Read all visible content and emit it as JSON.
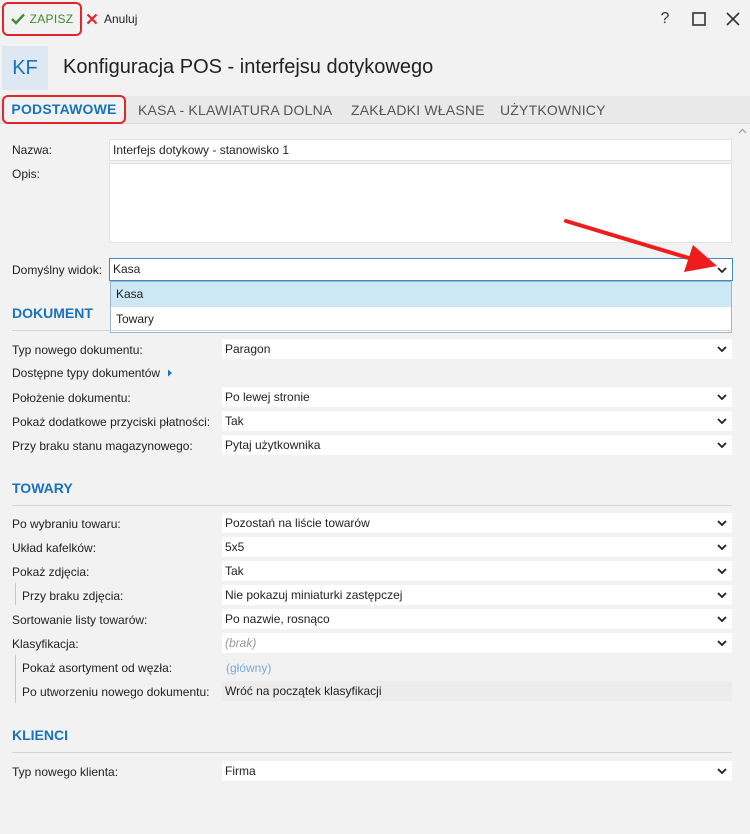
{
  "toolbar": {
    "save_label": "ZAPISZ",
    "cancel_label": "Anuluj",
    "help_glyph": "?",
    "maximize_glyph": "☐",
    "close_glyph": "✕"
  },
  "header": {
    "badge": "KF",
    "title": "Konfiguracja POS - interfejsu dotykowego"
  },
  "tabs": [
    {
      "label": "PODSTAWOWE",
      "active": true
    },
    {
      "label": "KASA - KLAWIATURA DOLNA",
      "active": false
    },
    {
      "label": "ZAKŁADKI WŁASNE",
      "active": false
    },
    {
      "label": "UŻYTKOWNICY",
      "active": false
    }
  ],
  "form": {
    "name_label": "Nazwa:",
    "name_value": "Interfejs dotykowy - stanowisko 1",
    "desc_label": "Opis:",
    "desc_value": "",
    "default_view_label": "Domyślny widok:",
    "default_view_value": "Kasa",
    "default_view_options": [
      "Kasa",
      "Towary"
    ]
  },
  "dokument": {
    "section_title": "DOKUMENT",
    "doc_type_label": "Typ nowego dokumentu:",
    "doc_type_value": "Paragon",
    "available_types_label": "Dostępne typy dokumentów",
    "position_label": "Położenie dokumentu:",
    "position_value": "Po lewej stronie",
    "extra_buttons_label": "Pokaż dodatkowe przyciski płatności:",
    "extra_buttons_value": "Tak",
    "no_stock_label": "Przy braku stanu magazynowego:",
    "no_stock_value": "Pytaj użytkownika"
  },
  "towary": {
    "section_title": "TOWARY",
    "after_select_label": "Po wybraniu towaru:",
    "after_select_value": "Pozostań na liście towarów",
    "tiles_label": "Układ kafelków:",
    "tiles_value": "5x5",
    "show_photo_label": "Pokaż zdjęcia:",
    "show_photo_value": "Tak",
    "no_photo_label": "Przy braku zdjęcia:",
    "no_photo_value": "Nie pokazuj miniaturki zastępczej",
    "sort_label": "Sortowanie listy towarów:",
    "sort_value": "Po nazwie, rosnąco",
    "class_label": "Klasyfikacja:",
    "class_value": "(brak)",
    "node_label": "Pokaż asortyment od węzła:",
    "node_value": "(główny)",
    "after_new_doc_label": "Po utworzeniu nowego dokumentu:",
    "after_new_doc_value": "Wróć na początek klasyfikacji"
  },
  "klienci": {
    "section_title": "KLIENCI",
    "client_type_label": "Typ nowego klienta:",
    "client_type_value": "Firma"
  },
  "colors": {
    "accent_blue": "#1a72ba",
    "highlight_red": "#e0252d",
    "save_green": "#3c8c2f"
  }
}
